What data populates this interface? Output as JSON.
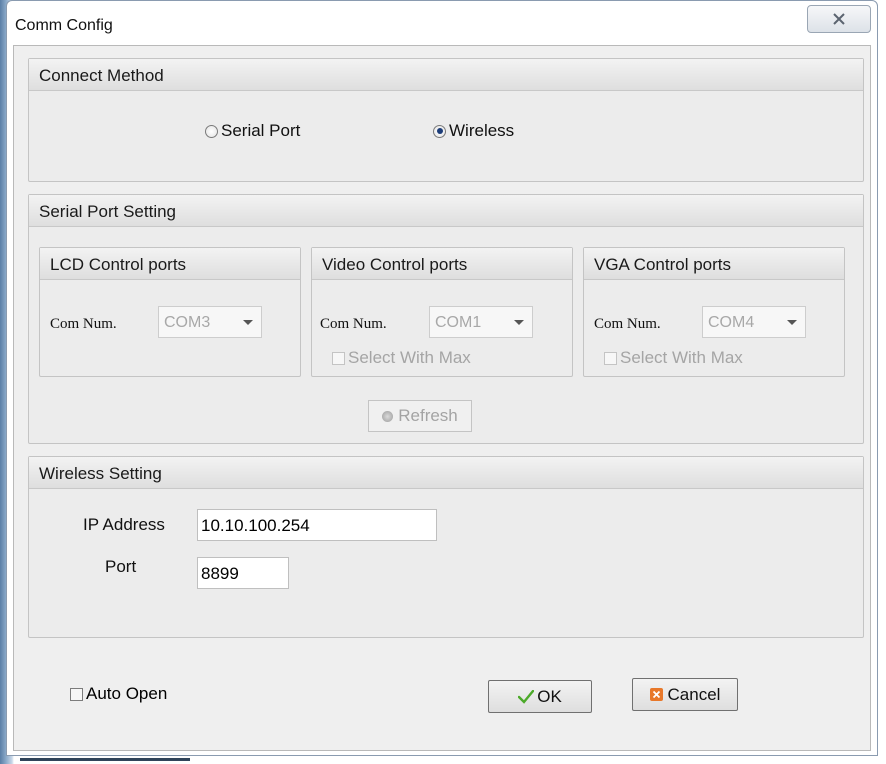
{
  "window": {
    "title": "Comm Config",
    "close_icon": "close-x-icon"
  },
  "connect_method": {
    "heading": "Connect Method",
    "options": [
      {
        "label": "Serial Port",
        "checked": false
      },
      {
        "label": "Wireless",
        "checked": true
      }
    ]
  },
  "serial": {
    "heading": "Serial Port Setting",
    "groups": [
      {
        "heading": "LCD Control ports",
        "com_label": "Com Num.",
        "com_value": "COM3"
      },
      {
        "heading": "Video Control ports",
        "com_label": "Com Num.",
        "com_value": "COM1",
        "select_max": "Select With Max"
      },
      {
        "heading": "VGA Control ports",
        "com_label": "Com Num.",
        "com_value": "COM4",
        "select_max": "Select With Max"
      }
    ],
    "refresh_label": "Refresh"
  },
  "wireless": {
    "heading": "Wireless Setting",
    "ip_label": "IP Address",
    "ip_value": "10.10.100.254",
    "port_label": "Port",
    "port_value": "8899"
  },
  "footer": {
    "auto_open_label": "Auto Open",
    "ok_label": "OK",
    "cancel_label": "Cancel"
  },
  "colors": {
    "ok_check": "#4caa2a",
    "cancel_icon": "#e8782a"
  }
}
